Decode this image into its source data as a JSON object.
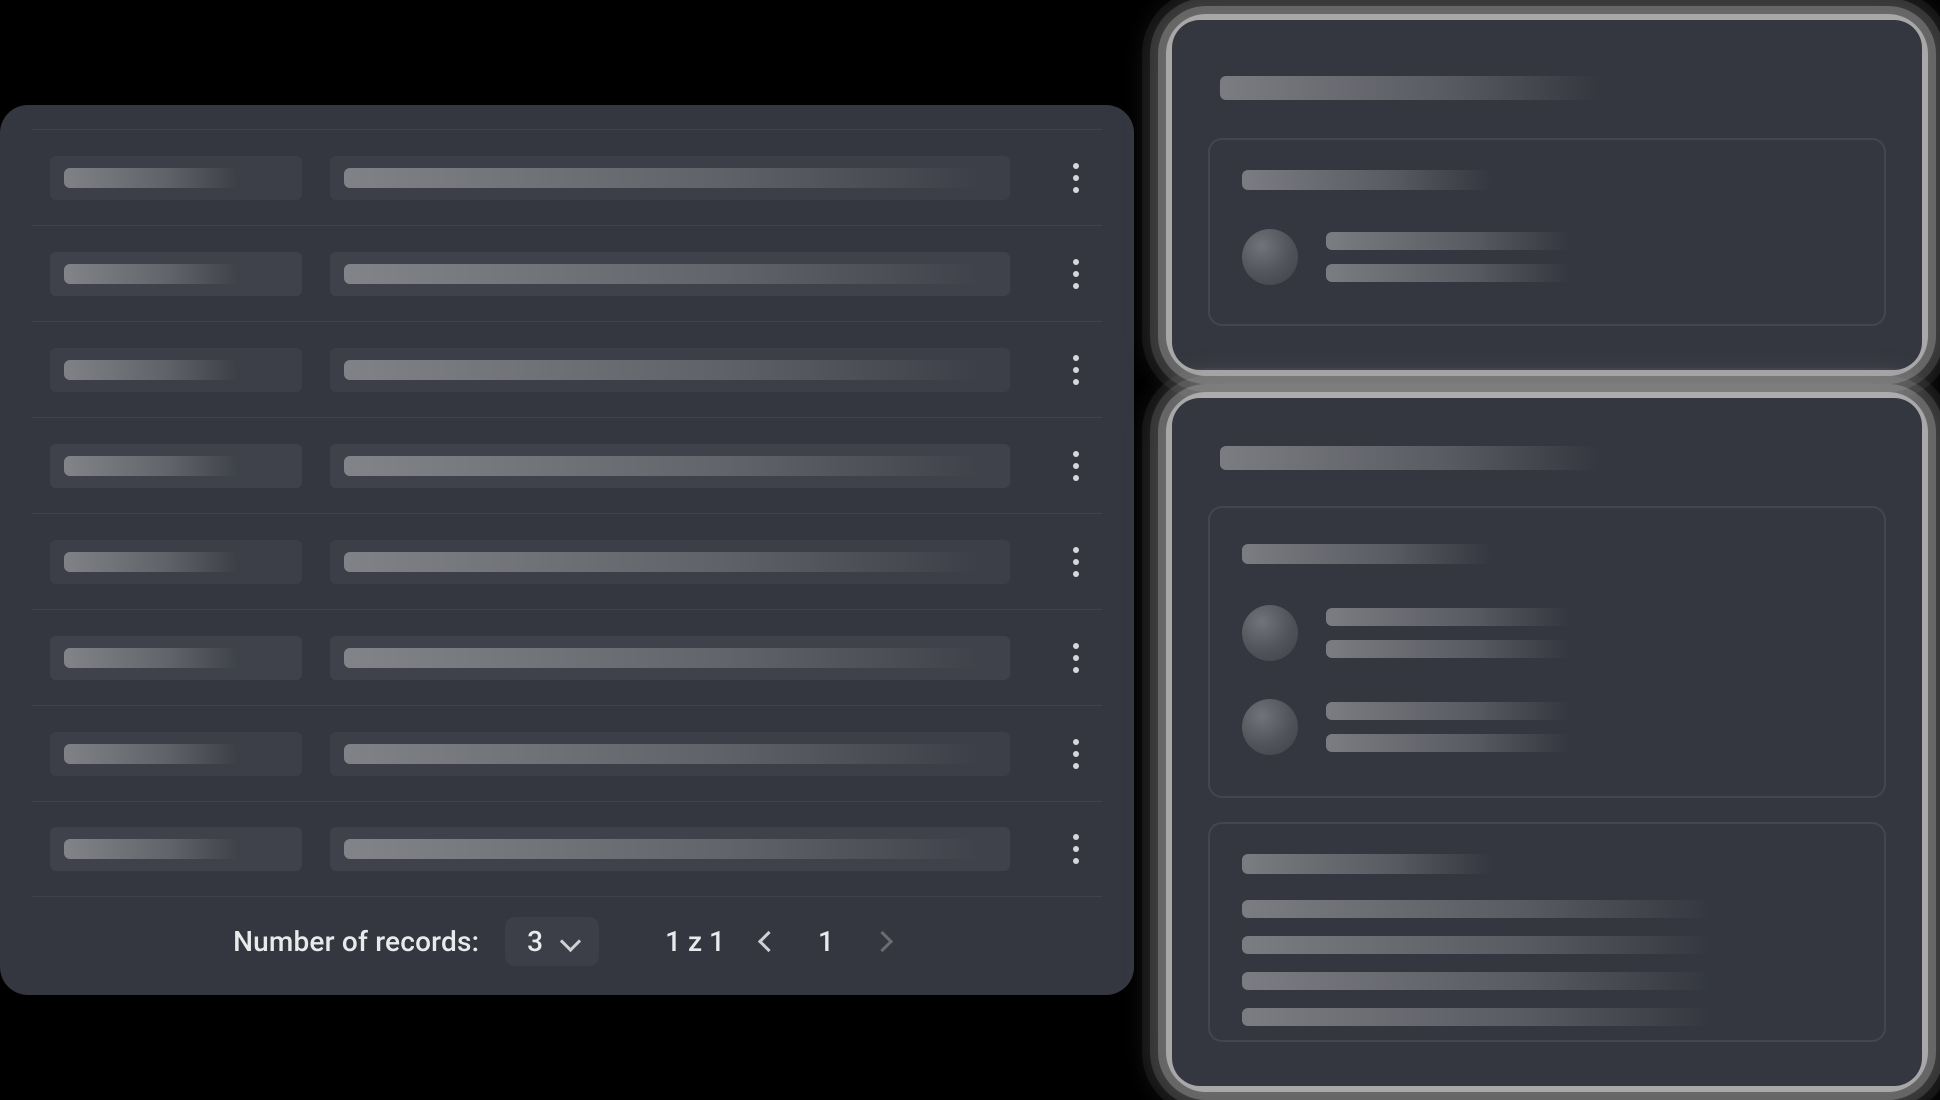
{
  "left_panel": {
    "rows": 8,
    "footer": {
      "records_label": "Number of records:",
      "page_size_value": "3",
      "page_indicator": "1 z 1",
      "current_page": "1"
    }
  }
}
